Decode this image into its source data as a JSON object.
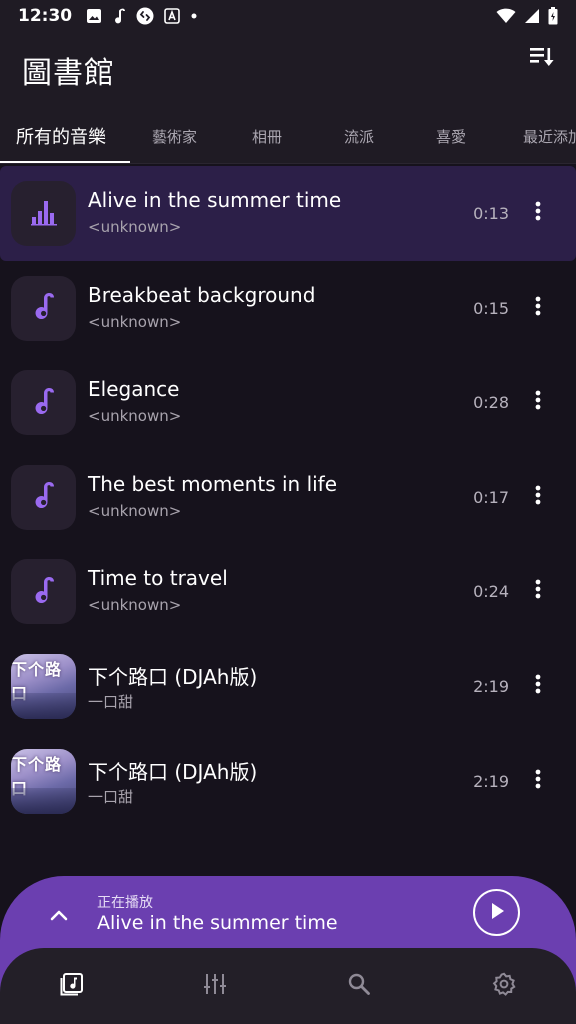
{
  "status_bar": {
    "time": "12:30",
    "left_icons": [
      "image-icon",
      "music-note-icon",
      "shazam-icon",
      "translate-icon",
      "dot-icon"
    ],
    "right_icons": [
      "wifi-icon",
      "signal-icon",
      "battery-icon"
    ]
  },
  "header": {
    "title": "圖書館",
    "sort_icon": "sort-icon"
  },
  "tabs": [
    {
      "label": "所有的音樂",
      "active": true
    },
    {
      "label": "藝術家",
      "active": false
    },
    {
      "label": "相冊",
      "active": false
    },
    {
      "label": "流派",
      "active": false
    },
    {
      "label": "喜愛",
      "active": false
    },
    {
      "label": "最近添加",
      "active": false
    }
  ],
  "songs": [
    {
      "title": "Alive in the summer time",
      "artist": "<unknown>",
      "duration": "0:13",
      "thumb": "equalizer-icon",
      "playing": true
    },
    {
      "title": "Breakbeat background",
      "artist": "<unknown>",
      "duration": "0:15",
      "thumb": "music-note-icon",
      "playing": false
    },
    {
      "title": "Elegance",
      "artist": "<unknown>",
      "duration": "0:28",
      "thumb": "music-note-icon",
      "playing": false
    },
    {
      "title": "The best moments in life",
      "artist": "<unknown>",
      "duration": "0:17",
      "thumb": "music-note-icon",
      "playing": false
    },
    {
      "title": "Time to travel",
      "artist": "<unknown>",
      "duration": "0:24",
      "thumb": "music-note-icon",
      "playing": false
    },
    {
      "title": "下个路口 (DJAh版)",
      "artist": "一口甜",
      "duration": "2:19",
      "thumb": "album-art",
      "art_text": "下个路口",
      "playing": false
    },
    {
      "title": "下个路口 (DJAh版)",
      "artist": "一口甜",
      "duration": "2:19",
      "thumb": "album-art",
      "art_text": "下个路口",
      "playing": false
    }
  ],
  "now_playing": {
    "label": "正在播放",
    "title": "Alive in the summer time",
    "expand_icon": "chevron-up-icon",
    "play_icon": "play-icon"
  },
  "bottom_nav": [
    {
      "icon": "library-music-icon",
      "active": true
    },
    {
      "icon": "equalizer-sliders-icon",
      "active": false
    },
    {
      "icon": "search-icon",
      "active": false
    },
    {
      "icon": "settings-icon",
      "active": false
    }
  ],
  "colors": {
    "background": "#16121c",
    "surface": "#1f1b24",
    "accent": "#8a4fe0",
    "playing_row": "#2c1f48",
    "now_playing_bar": "#6b3fb0"
  }
}
